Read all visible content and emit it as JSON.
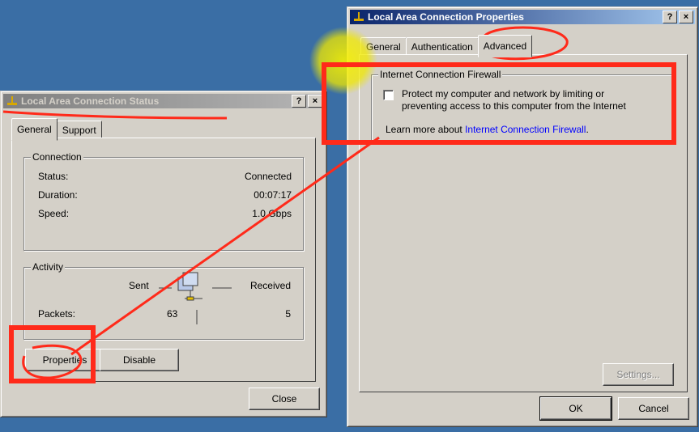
{
  "status_window": {
    "title": "Local Area Connection Status",
    "help_label": "?",
    "close_label": "×",
    "tabs": [
      "General",
      "Support"
    ],
    "connection": {
      "label": "Connection",
      "status_label": "Status:",
      "status_value": "Connected",
      "duration_label": "Duration:",
      "duration_value": "00:07:17",
      "speed_label": "Speed:",
      "speed_value": "1.0 Gbps"
    },
    "activity": {
      "label": "Activity",
      "sent_label": "Sent",
      "received_label": "Received",
      "packets_label": "Packets:",
      "packets_sent": "63",
      "packets_received": "5"
    },
    "properties_button": "Properties",
    "disable_button": "Disable",
    "close_button": "Close"
  },
  "properties_window": {
    "title": "Local Area Connection Properties",
    "help_label": "?",
    "close_label": "×",
    "tabs": [
      "General",
      "Authentication",
      "Advanced"
    ],
    "firewall": {
      "label": "Internet Connection Firewall",
      "checkbox_line1": "Protect my computer and network by limiting or",
      "checkbox_line2": "preventing access to this computer from the Internet",
      "learn_more_prefix": "Learn more about ",
      "learn_more_link": "Internet Connection Firewall",
      "learn_more_suffix": "."
    },
    "settings_button": "Settings...",
    "ok_button": "OK",
    "cancel_button": "Cancel"
  },
  "colors": {
    "desktop": "#3a6ea5",
    "annotation_red": "#ff2a1a",
    "highlight_yellow": "#f5f000"
  }
}
